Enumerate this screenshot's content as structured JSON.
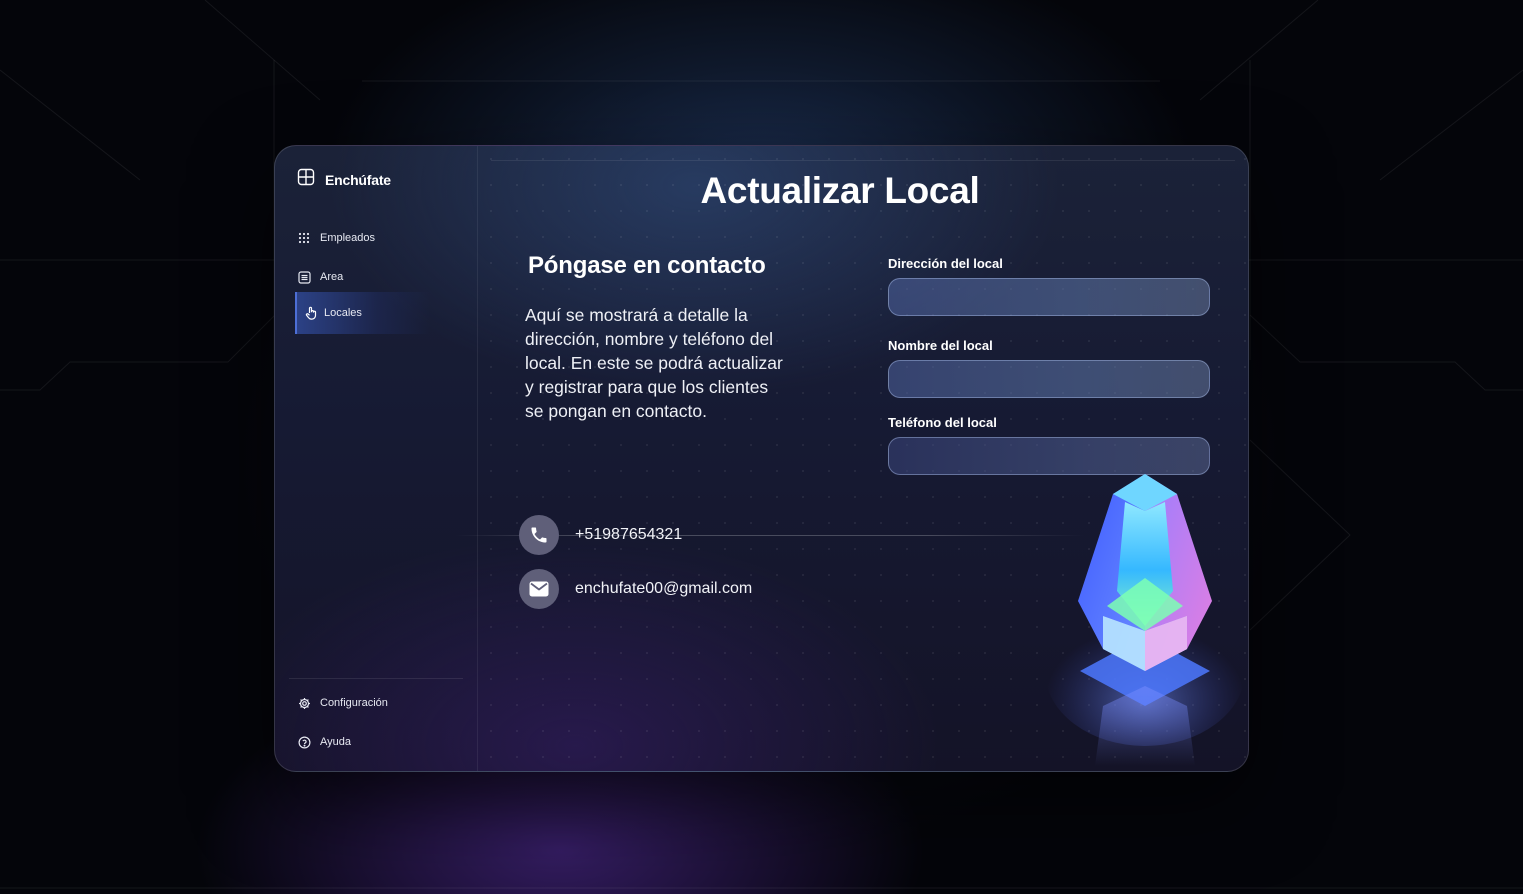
{
  "app": {
    "brand": "Enchúfate"
  },
  "sidebar": {
    "items": [
      {
        "label": "Empleados",
        "icon": "grid-dots-icon",
        "active": false
      },
      {
        "label": "Area",
        "icon": "list-icon",
        "active": false
      },
      {
        "label": "Locales",
        "icon": "hand-pointer-icon",
        "active": true
      }
    ],
    "bottom_items": [
      {
        "label": "Configuración",
        "icon": "gear-icon"
      },
      {
        "label": "Ayuda",
        "icon": "help-circle-icon"
      }
    ]
  },
  "main": {
    "title": "Actualizar Local",
    "contact_heading": "Póngase en contacto",
    "description": "Aquí se mostrará a detalle la dirección, nombre y teléfono del local. En este se podrá actualizar y registrar para que los clientes se pongan en contacto.",
    "phone": "+51987654321",
    "email": "enchufate00@gmail.com"
  },
  "form": {
    "fields": [
      {
        "label": "Dirección del local",
        "value": ""
      },
      {
        "label": "Nombre del local",
        "value": ""
      },
      {
        "label": "Teléfono del local",
        "value": ""
      }
    ]
  },
  "colors": {
    "accent": "#4d6fd6",
    "background": "#04050a",
    "panel": "#161a33"
  }
}
